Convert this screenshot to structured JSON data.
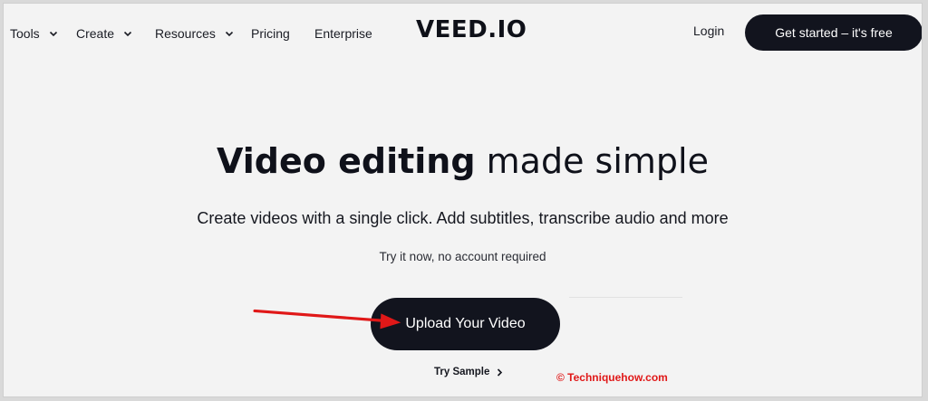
{
  "nav": {
    "items": [
      {
        "label": "Tools",
        "has_dropdown": true
      },
      {
        "label": "Create",
        "has_dropdown": true
      },
      {
        "label": "Resources",
        "has_dropdown": true
      },
      {
        "label": "Pricing",
        "has_dropdown": false
      },
      {
        "label": "Enterprise",
        "has_dropdown": false
      }
    ],
    "logo": "VEED.IO",
    "login": "Login",
    "cta": "Get started – it's free"
  },
  "hero": {
    "title_bold": "Video editing",
    "title_rest": " made simple",
    "subtitle": "Create videos with a single click. Add subtitles, transcribe audio and more",
    "note": "Try it now, no account required",
    "upload_button": "Upload Your Video",
    "try_sample": "Try Sample"
  },
  "watermark": "© Techniquehow.com",
  "colors": {
    "dark": "#12141e",
    "background": "#f3f3f3",
    "annotation_red": "#e01818"
  },
  "icons": {
    "dropdown": "chevron-down-icon",
    "try_sample_arrow": "chevron-right-icon",
    "annotation": "red-arrow-icon"
  }
}
